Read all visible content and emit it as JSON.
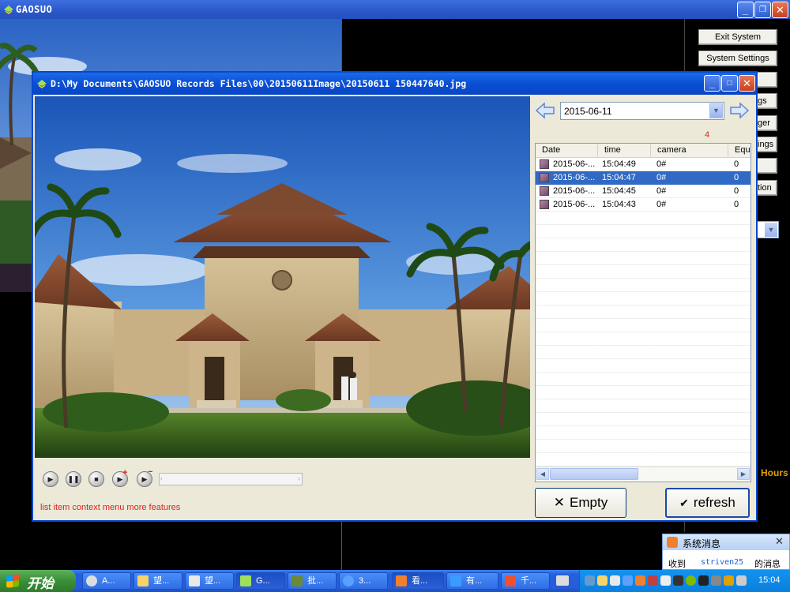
{
  "main_window": {
    "title": "GAOSUO"
  },
  "side_panel": {
    "buttons": [
      "Exit System",
      "System Settings",
      "",
      "gs",
      "ger",
      "ings",
      "",
      "tion"
    ],
    "hours_label": "Hours"
  },
  "viewer": {
    "title": "D:\\My Documents\\GAOSUO Records Files\\00\\20150611Image\\20150611 150447640.jpg",
    "status_text": "list item context menu more features",
    "date_value": "2015-06-11",
    "count": "4",
    "columns": [
      "Date",
      "time",
      "camera",
      "Equ"
    ],
    "rows": [
      {
        "date": "2015-06-...",
        "time": "15:04:49",
        "camera": "0#",
        "equ": "0",
        "selected": false
      },
      {
        "date": "2015-06-...",
        "time": "15:04:47",
        "camera": "0#",
        "equ": "0",
        "selected": true
      },
      {
        "date": "2015-06-...",
        "time": "15:04:45",
        "camera": "0#",
        "equ": "0",
        "selected": false
      },
      {
        "date": "2015-06-...",
        "time": "15:04:43",
        "camera": "0#",
        "equ": "0",
        "selected": false
      }
    ],
    "empty_label": "Empty",
    "refresh_label": "refresh"
  },
  "notification": {
    "title": "系统消息",
    "body_prefix": "收到",
    "sender": "striven25",
    "body_suffix": "的消息"
  },
  "taskbar": {
    "start_label": "开始",
    "tasks": [
      "A...",
      "望...",
      "望...",
      "G...",
      "批...",
      "3...",
      "看...",
      "有...",
      "千..."
    ],
    "clock": "15:04"
  },
  "colors": {
    "accent": "#316ac5",
    "title_blue": "#0a4fd4",
    "alert_red": "#e02020"
  }
}
